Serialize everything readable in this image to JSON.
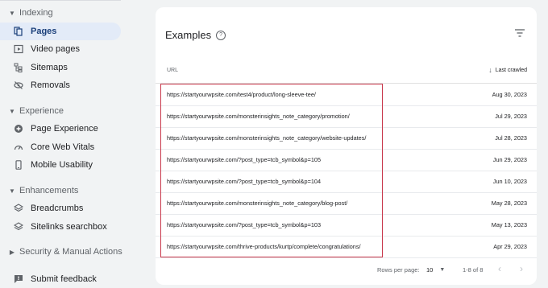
{
  "sidebar": {
    "sections": [
      {
        "label": "Indexing",
        "expanded": true
      },
      {
        "label": "Experience",
        "expanded": true
      },
      {
        "label": "Enhancements",
        "expanded": true
      },
      {
        "label": "Security & Manual Actions",
        "expanded": false
      }
    ],
    "items": [
      {
        "label": "Pages",
        "icon": "pages-icon",
        "active": true
      },
      {
        "label": "Video pages",
        "icon": "video-pages-icon"
      },
      {
        "label": "Sitemaps",
        "icon": "sitemaps-icon"
      },
      {
        "label": "Removals",
        "icon": "removals-icon"
      },
      {
        "label": "Page Experience",
        "icon": "page-experience-icon"
      },
      {
        "label": "Core Web Vitals",
        "icon": "gauge-icon"
      },
      {
        "label": "Mobile Usability",
        "icon": "phone-icon"
      },
      {
        "label": "Breadcrumbs",
        "icon": "layers-icon"
      },
      {
        "label": "Sitelinks searchbox",
        "icon": "layers-icon"
      },
      {
        "label": "Submit feedback",
        "icon": "feedback-icon"
      }
    ]
  },
  "examples": {
    "title": "Examples",
    "col_url": "URL",
    "col_last_crawled": "Last crawled",
    "rows": [
      {
        "url": "https://startyourwpsite.com/test4/product/long-sleeve-tee/",
        "date": "Aug 30, 2023"
      },
      {
        "url": "https://startyourwpsite.com/monsterinsights_note_category/promotion/",
        "date": "Jul 29, 2023"
      },
      {
        "url": "https://startyourwpsite.com/monsterinsights_note_category/website-updates/",
        "date": "Jul 28, 2023"
      },
      {
        "url": "https://startyourwpsite.com/?post_type=tcb_symbol&p=105",
        "date": "Jun 29, 2023"
      },
      {
        "url": "https://startyourwpsite.com/?post_type=tcb_symbol&p=104",
        "date": "Jun 10, 2023"
      },
      {
        "url": "https://startyourwpsite.com/monsterinsights_note_category/blog-post/",
        "date": "May 28, 2023"
      },
      {
        "url": "https://startyourwpsite.com/?post_type=tcb_symbol&p=103",
        "date": "May 13, 2023"
      },
      {
        "url": "https://startyourwpsite.com/thrive-products/kurtp/complete/congratulations/",
        "date": "Apr 29, 2023"
      }
    ],
    "rows_per_page_label": "Rows per page:",
    "rows_per_page_value": "10",
    "range_text": "1-8 of 8"
  },
  "colors": {
    "accent": "#1a73e8",
    "active_bg": "#e3ebf8",
    "highlight": "#c8374a"
  }
}
